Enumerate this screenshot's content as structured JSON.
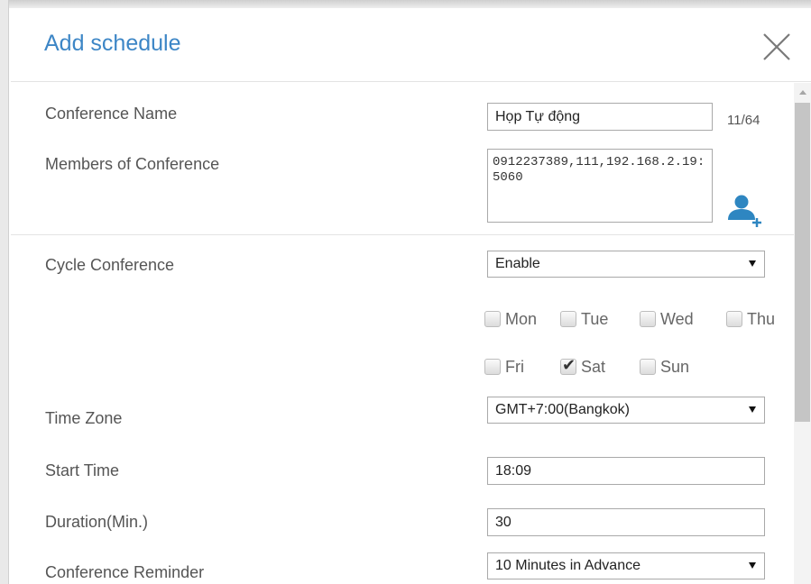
{
  "dialog": {
    "title": "Add schedule",
    "close_icon": "close-icon"
  },
  "form": {
    "conference_name": {
      "label": "Conference Name",
      "value": "Họp Tự động",
      "counter": "11/64"
    },
    "members": {
      "label": "Members of Conference",
      "value": "0912237389,111,192.168.2.19:5060",
      "add_icon": "add-user-icon"
    },
    "cycle": {
      "label": "Cycle Conference",
      "selected": "Enable"
    },
    "days": [
      {
        "label": "Mon",
        "checked": false
      },
      {
        "label": "Tue",
        "checked": false
      },
      {
        "label": "Wed",
        "checked": false
      },
      {
        "label": "Thu",
        "checked": false
      },
      {
        "label": "Fri",
        "checked": false
      },
      {
        "label": "Sat",
        "checked": true
      },
      {
        "label": "Sun",
        "checked": false
      }
    ],
    "time_zone": {
      "label": "Time Zone",
      "selected": "GMT+7:00(Bangkok)"
    },
    "start_time": {
      "label": "Start Time",
      "value": "18:09"
    },
    "duration": {
      "label": "Duration(Min.)",
      "value": "30"
    },
    "reminder": {
      "label": "Conference Reminder",
      "selected": "10 Minutes in Advance"
    }
  },
  "colors": {
    "title": "#3d86c6",
    "add_user_icon": "#2e86c1",
    "label_text": "#555555"
  }
}
